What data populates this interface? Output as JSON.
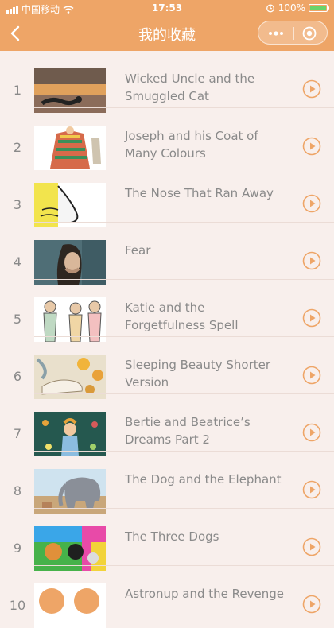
{
  "status_bar": {
    "carrier": "中国移动",
    "time": "17:53",
    "battery": "100%"
  },
  "nav": {
    "title": "我的收藏"
  },
  "items": [
    {
      "index": "1",
      "title": "Wicked Uncle and the Smuggled Cat"
    },
    {
      "index": "2",
      "title": "Joseph and his Coat of Many Colours"
    },
    {
      "index": "3",
      "title": "The Nose That Ran Away"
    },
    {
      "index": "4",
      "title": "Fear"
    },
    {
      "index": "5",
      "title": "Katie and the Forgetfulness Spell"
    },
    {
      "index": "6",
      "title": "Sleeping Beauty Shorter Version"
    },
    {
      "index": "7",
      "title": "Bertie and Beatrice’s Dreams Part 2"
    },
    {
      "index": "8",
      "title": "The Dog and the Elephant"
    },
    {
      "index": "9",
      "title": "The Three Dogs"
    },
    {
      "index": "10",
      "title": "Astronup and the Revenge"
    }
  ],
  "colors": {
    "accent": "#eea567",
    "background": "#f8efec",
    "text": "#8a8a8a"
  }
}
